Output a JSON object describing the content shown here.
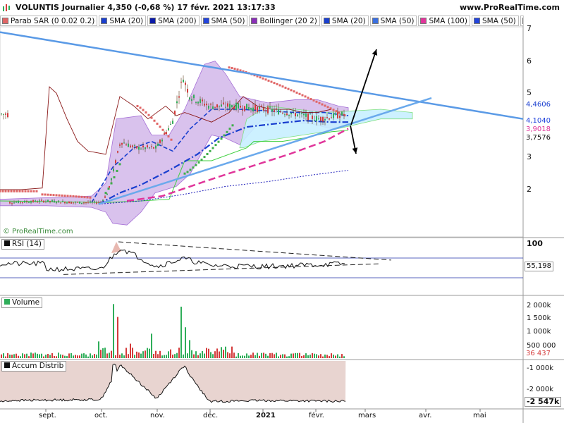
{
  "header": {
    "title": "VOLUNTIS Journalier 4,350 (-0,68 %) 17 févr. 2021 13:17:33",
    "site": "www.ProRealTime.com",
    "copyright": "© ProRealTime.com"
  },
  "legend": [
    {
      "label": "Parab SAR (0 0.02 0.2)",
      "color": "#e06666"
    },
    {
      "label": "SMA (20)",
      "color": "#1a3fcf"
    },
    {
      "label": "SMA (200)",
      "color": "#0a1aa8"
    },
    {
      "label": "SMA (50)",
      "color": "#2244dd"
    },
    {
      "label": "Bollinger (20 2)",
      "color": "#8a2fb8"
    },
    {
      "label": "SMA (20)",
      "color": "#1a3fcf"
    },
    {
      "label": "SMA (50)",
      "color": "#3a6fe0"
    },
    {
      "label": "SMA (100)",
      "color": "#e0359a"
    },
    {
      "label": "SMA (50)",
      "color": "#2244dd"
    },
    {
      "label": "SMA",
      "color": "#2fae5a"
    }
  ],
  "colors": {
    "candle_up": "#2fae5a",
    "candle_down": "#d43a3a",
    "trendline": "#5a9ae6",
    "sar": "#e06666",
    "sar_up": "#3fae4a",
    "bollinger_fill": "#c9a8e6",
    "cloud_fill": "#c8f0ff",
    "sma200": "#2222bb",
    "sma100": "#e0359a",
    "rsi_line": "#111111",
    "accum_fill": "#e8d4d0",
    "accum_line": "#111111"
  },
  "panels": {
    "rsi": {
      "label": "RSI (14)",
      "level_top": "100",
      "last_value": "55,198"
    },
    "volume": {
      "label": "Volume",
      "last_value": "36 437",
      "ticks": [
        "2 000k",
        "1 500k",
        "1 000k",
        "500 000"
      ]
    },
    "accum": {
      "label": "Accum Distrib",
      "last_value": "-2 547k",
      "ticks": [
        "-1 000k",
        "-2 000k"
      ]
    }
  },
  "price_axis": {
    "ticks": [
      "7",
      "6",
      "5",
      "4",
      "3",
      "2"
    ],
    "value_labels": [
      {
        "text": "4,4606",
        "color": "#1a3fcf",
        "bg": "#ffffff"
      },
      {
        "text": "4,1040",
        "color": "#2244dd",
        "bg": "#ffffff"
      },
      {
        "text": "3,9018",
        "color": "#e0359a",
        "bg": "#ffffff"
      },
      {
        "text": "3,7576",
        "color": "#111111",
        "bg": "#ffffff"
      }
    ]
  },
  "x_axis": {
    "labels": [
      "sept.",
      "oct.",
      "nov.",
      "déc.",
      "2021",
      "févr.",
      "mars",
      "avr.",
      "mai"
    ]
  },
  "chart_data": [
    {
      "type": "line",
      "title": "VOLUNTIS Journalier",
      "x": [
        "2020-08-20",
        "2020-09-01",
        "2020-09-15",
        "2020-10-01",
        "2020-10-05",
        "2020-10-12",
        "2020-10-20",
        "2020-11-01",
        "2020-11-10",
        "2020-11-16",
        "2020-11-20",
        "2020-12-01",
        "2020-12-15",
        "2021-01-01",
        "2021-01-15",
        "2021-02-01",
        "2021-02-17"
      ],
      "series": [
        {
          "name": "Close",
          "values": [
            1.6,
            1.65,
            1.6,
            1.6,
            1.9,
            3.5,
            3.3,
            3.3,
            4.1,
            5.5,
            4.9,
            4.6,
            4.6,
            4.5,
            4.4,
            4.2,
            4.35
          ]
        }
      ],
      "ylim": [
        1.0,
        7.2
      ],
      "annotations": [
        "trendline resistance",
        "trendline support",
        "arrow up",
        "arrow down"
      ]
    },
    {
      "type": "line",
      "title": "RSI (14)",
      "x": [
        "2020-09-01",
        "2020-10-01",
        "2020-10-12",
        "2020-11-01",
        "2020-11-16",
        "2020-12-01",
        "2021-01-01",
        "2021-02-17"
      ],
      "series": [
        {
          "name": "RSI (14)",
          "values": [
            45,
            45,
            85,
            50,
            65,
            52,
            50,
            55.198
          ]
        }
      ],
      "ylim": [
        0,
        100
      ]
    },
    {
      "type": "bar",
      "title": "Volume",
      "categories": [
        "sept.",
        "oct.",
        "oct.",
        "nov.",
        "nov.",
        "déc.",
        "2021",
        "févr."
      ],
      "values": [
        30000,
        90000,
        2100000,
        900000,
        2000000,
        250000,
        200000,
        36437
      ],
      "ylim": [
        0,
        2300000
      ]
    },
    {
      "type": "area",
      "title": "Accum Distrib",
      "x": [
        "2020-08-20",
        "2020-10-01",
        "2020-10-12",
        "2020-11-01",
        "2020-11-16",
        "2020-12-01",
        "2021-01-01",
        "2021-02-17"
      ],
      "series": [
        {
          "name": "Accum Distrib",
          "values": [
            -2500000,
            -2450000,
            -600000,
            -2400000,
            -700000,
            -2550000,
            -2500000,
            -2547000
          ]
        }
      ],
      "ylim": [
        -2800000,
        -500000
      ]
    }
  ]
}
